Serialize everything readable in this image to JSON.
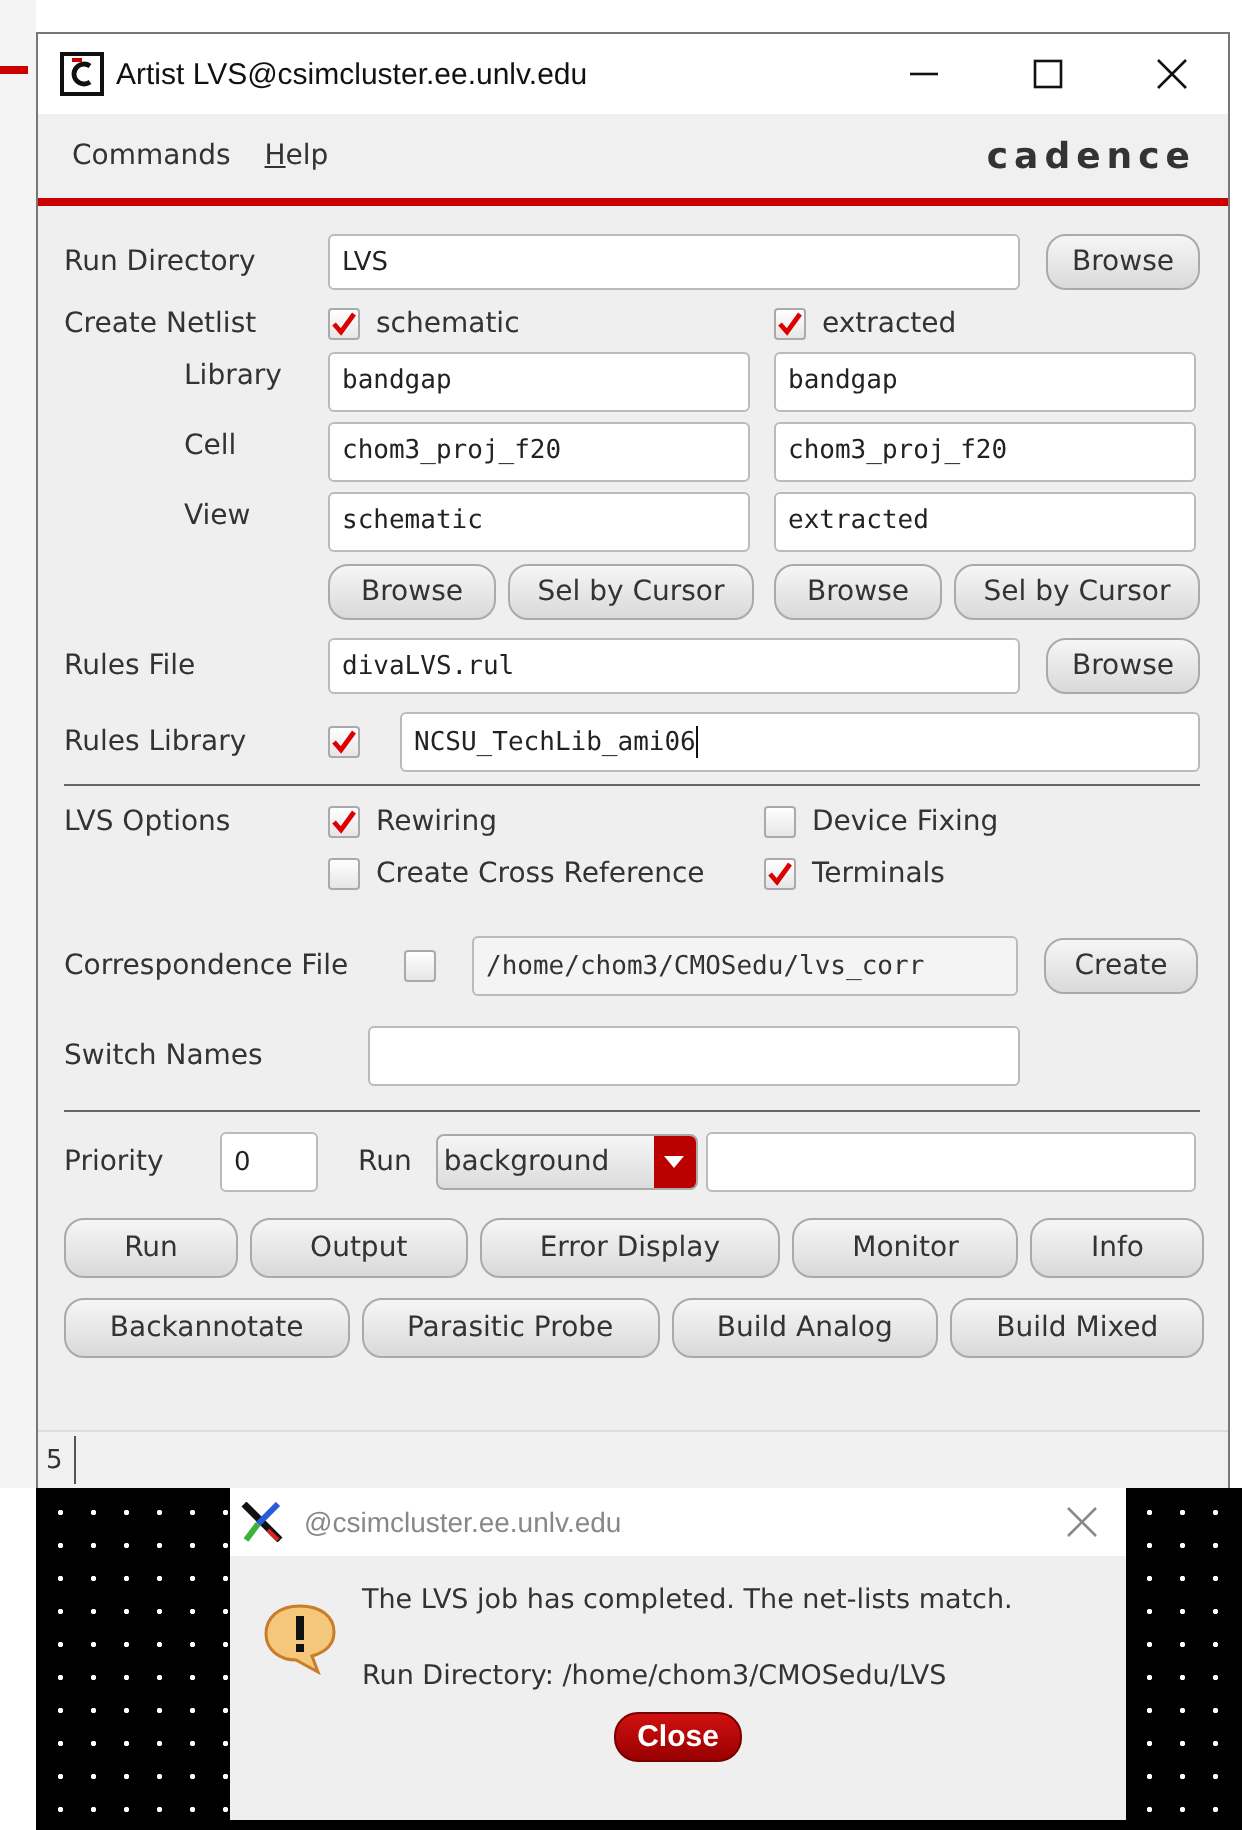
{
  "window": {
    "title": "Artist LVS@csimcluster.ee.unlv.edu"
  },
  "menu": [
    {
      "label": "Commands",
      "underlined": false
    },
    {
      "label": "Help",
      "underlined": true
    }
  ],
  "logo": "cadence",
  "run_directory": {
    "label": "Run Directory",
    "value": "LVS",
    "button": "Browse"
  },
  "create_netlist": {
    "label": "Create Netlist",
    "options": [
      {
        "label": "schematic",
        "checked": true
      },
      {
        "label": "extracted",
        "checked": true
      }
    ],
    "fields": [
      {
        "label": "Library",
        "values": [
          "bandgap",
          "bandgap"
        ]
      },
      {
        "label": "Cell",
        "values": [
          "chom3_proj_f20",
          "chom3_proj_f20"
        ]
      },
      {
        "label": "View",
        "values": [
          "schematic",
          "extracted"
        ]
      }
    ],
    "buttons": [
      [
        "Browse",
        "Sel by Cursor"
      ],
      [
        "Browse",
        "Sel by Cursor"
      ]
    ]
  },
  "rules_file": {
    "label": "Rules File",
    "value": "divaLVS.rul",
    "button": "Browse"
  },
  "rules_library": {
    "label": "Rules Library",
    "checked": true,
    "value": "NCSU_TechLib_ami06"
  },
  "lvs_options": {
    "label": "LVS Options",
    "options": [
      {
        "label": "Rewiring",
        "checked": true
      },
      {
        "label": "Device Fixing",
        "checked": false
      },
      {
        "label": "Create Cross Reference",
        "checked": false
      },
      {
        "label": "Terminals",
        "checked": true
      }
    ]
  },
  "correspondence_file": {
    "label": "Correspondence File",
    "checked": false,
    "value": "/home/chom3/CMOSedu/lvs_corr",
    "button": "Create"
  },
  "switch_names": {
    "label": "Switch Names"
  },
  "priority": {
    "label": "Priority",
    "value": "0"
  },
  "run_mode": {
    "label": "Run",
    "value": "background"
  },
  "actions": [
    [
      "Run",
      "Output",
      "Error Display",
      "Monitor",
      "Info"
    ],
    [
      "Backannotate",
      "Parasitic Probe",
      "Build Analog",
      "Build Mixed"
    ]
  ],
  "status": {
    "line": "5"
  },
  "dialog": {
    "title": "@csimcluster.ee.unlv.edu",
    "message": "The LVS job has completed. The net-lists match.",
    "detail": "Run Directory: /home/chom3/CMOSedu/LVS",
    "button": "Close"
  }
}
